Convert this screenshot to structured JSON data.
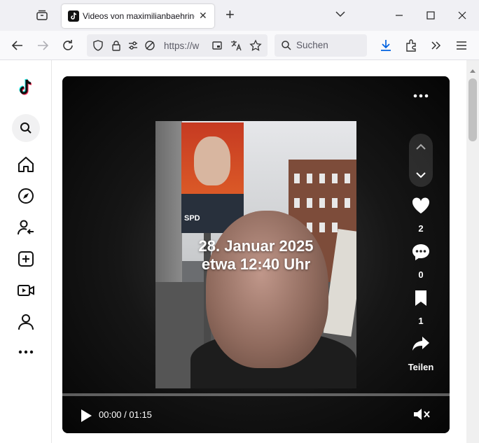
{
  "browser": {
    "tab_title": "Videos von maximilianbaehring",
    "tab_close": "✕",
    "new_tab": "+",
    "url": "https://w",
    "search_placeholder": "Suchen"
  },
  "sidebar": {
    "items": [
      "tiktok-logo",
      "search",
      "home",
      "explore",
      "following",
      "upload",
      "live",
      "profile",
      "more"
    ]
  },
  "video": {
    "overlay_line1": "28. Januar 2025",
    "overlay_line2": "etwa 12:40 Uhr",
    "poster_text": "SPD",
    "time": "00:00 / 01:15",
    "likes": "2",
    "comments": "0",
    "saves": "1",
    "share_label": "Teilen",
    "progress_fraction": 0.0
  },
  "colors": {
    "accent_download": "#0061e0",
    "player_bg": "#000000"
  }
}
